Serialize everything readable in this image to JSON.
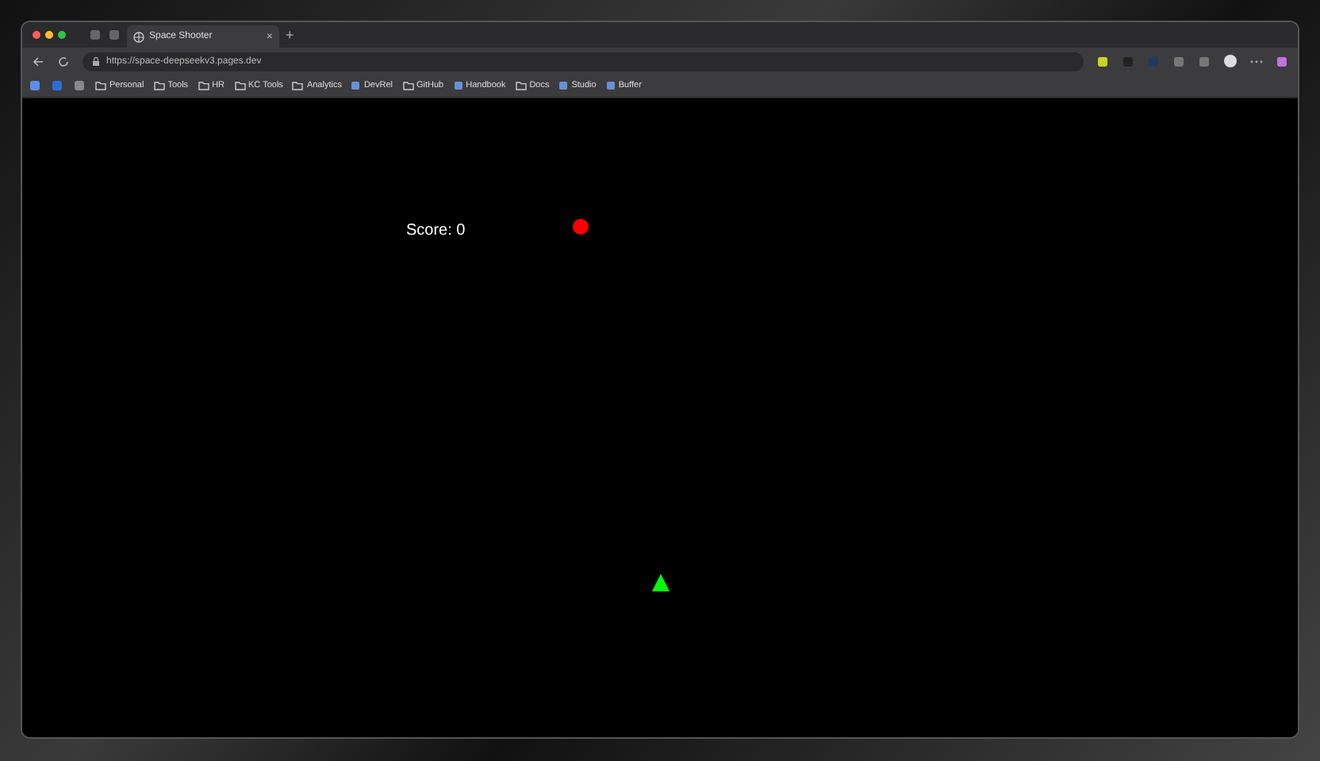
{
  "tab": {
    "title": "Space Shooter",
    "close": "×",
    "new_tab": "+"
  },
  "address_bar": {
    "url": "https://space-deepseekv3.pages.dev"
  },
  "bookmarks": [
    {
      "label": "Personal",
      "kind": "folder"
    },
    {
      "label": "Tools",
      "kind": "folder"
    },
    {
      "label": "HR",
      "kind": "folder"
    },
    {
      "label": "KC Tools",
      "kind": "folder"
    },
    {
      "label": "Analytics",
      "kind": "folder"
    },
    {
      "label": "DevRel",
      "kind": "site"
    },
    {
      "label": "GitHub",
      "kind": "folder"
    },
    {
      "label": "Handbook",
      "kind": "site"
    },
    {
      "label": "Docs",
      "kind": "folder"
    },
    {
      "label": "Studio",
      "kind": "site"
    },
    {
      "label": "Buffer",
      "kind": "site"
    }
  ],
  "game": {
    "score": "Score: 0"
  }
}
